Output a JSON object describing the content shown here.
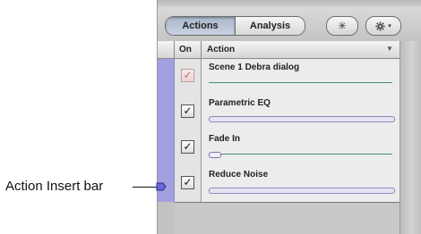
{
  "toolbar": {
    "tabs": [
      {
        "label": "Actions",
        "selected": true
      },
      {
        "label": "Analysis",
        "selected": false
      }
    ],
    "asterisk_label": "✳",
    "gear_icon": "gear-icon",
    "chevron": "▾"
  },
  "table": {
    "columns": {
      "on": "On",
      "action": "Action"
    },
    "sort_glyph": "▼",
    "rows": [
      {
        "name": "Scene 1 Debra dialog",
        "checked": true,
        "enabled": false
      },
      {
        "name": "Parametric EQ",
        "checked": true,
        "enabled": true
      },
      {
        "name": "Fade In",
        "checked": true,
        "enabled": true
      },
      {
        "name": "Reduce Noise",
        "checked": true,
        "enabled": true
      }
    ],
    "check_glyph": "✓"
  },
  "callout": {
    "label": "Action Insert bar"
  },
  "colors": {
    "insert_bar": "#a3a0e0",
    "insert_marker": "#2c2a8f",
    "row_bg": "#ececec",
    "panel_bg": "#c9c9c9"
  }
}
